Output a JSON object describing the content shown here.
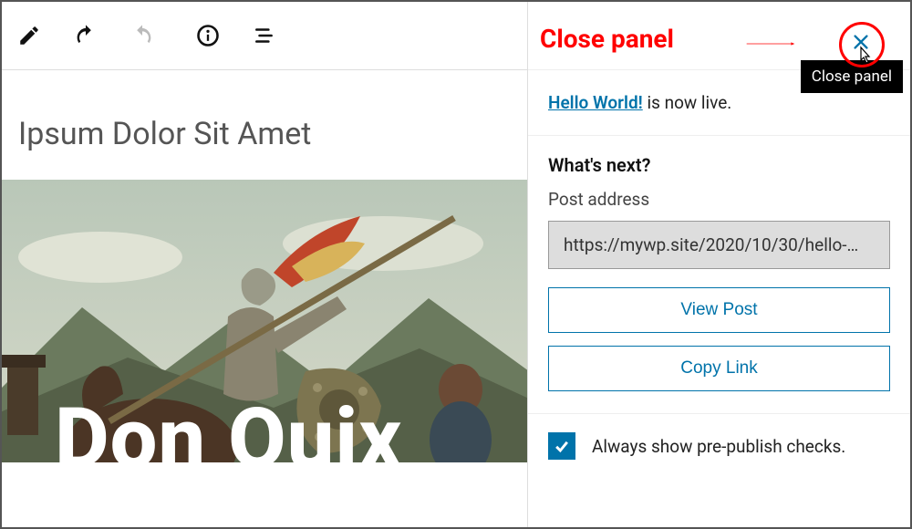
{
  "toolbar": {
    "edit_tooltip": "Edit",
    "undo_tooltip": "Undo",
    "redo_tooltip": "Redo",
    "info_tooltip": "Details",
    "outline_tooltip": "Outline"
  },
  "editor": {
    "post_title": "Ipsum Dolor Sit Amet",
    "hero_title": "Don Quix"
  },
  "panel": {
    "close_tooltip": "Close panel",
    "notice_link": "Hello World!",
    "notice_rest": " is now live.",
    "whats_next": "What's next?",
    "address_label": "Post address",
    "address_value": "https://mywp.site/2020/10/30/hello-…",
    "view_label": "View Post",
    "copy_label": "Copy Link",
    "prepublish_label": "Always show pre-publish checks.",
    "prepublish_checked": true
  },
  "annotation": {
    "label": "Close panel"
  }
}
